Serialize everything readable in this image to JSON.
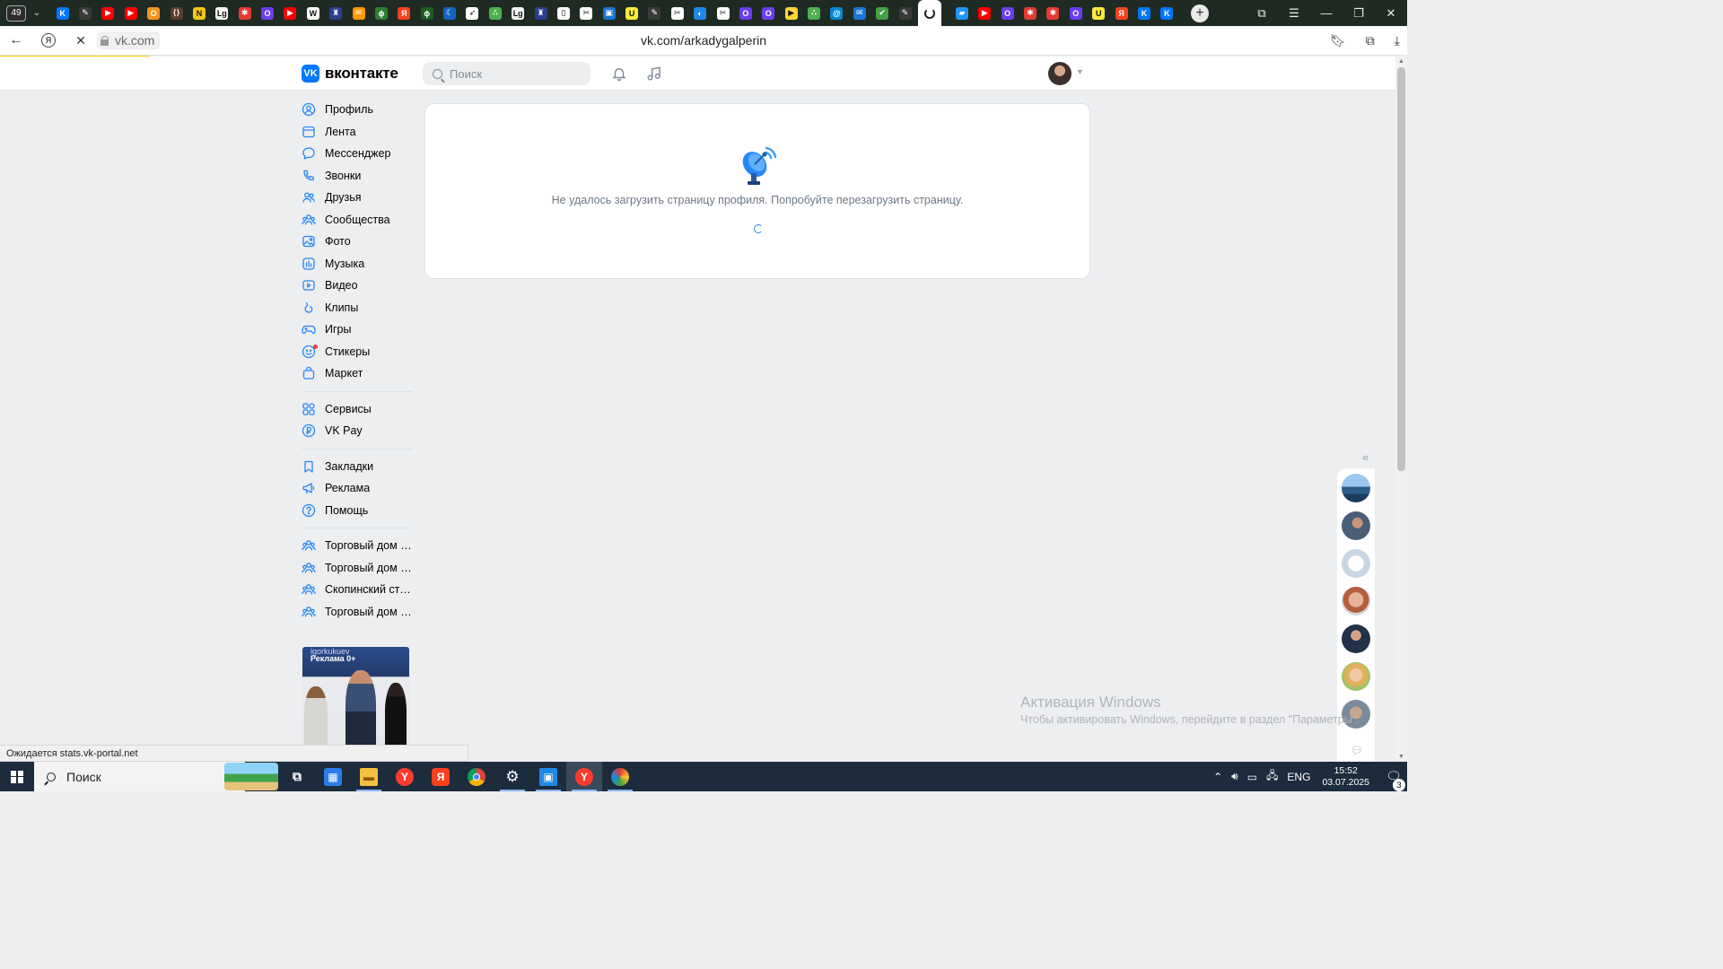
{
  "browser": {
    "tab_count": "49",
    "tab_icons": [
      {
        "name": "vk-icon",
        "color": "#0077ff",
        "glyph": "K"
      },
      {
        "name": "pen-icon",
        "color": "#3a3a3a",
        "glyph": "✎"
      },
      {
        "name": "youtube-icon",
        "color": "#ff0000",
        "glyph": "▶"
      },
      {
        "name": "youtube-icon",
        "color": "#ff0000",
        "glyph": "▶"
      },
      {
        "name": "ok-icon",
        "color": "#f7931e",
        "glyph": "O"
      },
      {
        "name": "code-icon",
        "color": "#5a3d2b",
        "glyph": "⟨⟩"
      },
      {
        "name": "n-icon",
        "color": "#f5c518",
        "glyph": "N"
      },
      {
        "name": "lg-icon",
        "color": "#f5f5f5",
        "glyph": "Lg"
      },
      {
        "name": "star-icon",
        "color": "#e53935",
        "glyph": "✱"
      },
      {
        "name": "o-icon",
        "color": "#6a3df0",
        "glyph": "O"
      },
      {
        "name": "youtube-icon",
        "color": "#ff0000",
        "glyph": "▶"
      },
      {
        "name": "w-icon",
        "color": "#ffffff",
        "glyph": "W"
      },
      {
        "name": "emblem-icon",
        "color": "#2a3f8f",
        "glyph": "♜"
      },
      {
        "name": "mail-icon",
        "color": "#ff9800",
        "glyph": "✉"
      },
      {
        "name": "leaf-icon",
        "color": "#2e7d32",
        "glyph": "ϕ"
      },
      {
        "name": "yandex-icon",
        "color": "#fc3f1d",
        "glyph": "Я"
      },
      {
        "name": "leaf-icon",
        "color": "#1b5e20",
        "glyph": "ϕ"
      },
      {
        "name": "moon-icon",
        "color": "#1565c0",
        "glyph": "☾"
      },
      {
        "name": "compass-icon",
        "color": "#ffffff",
        "glyph": "➶"
      },
      {
        "name": "dots-icon",
        "color": "#4caf50",
        "glyph": "∴"
      },
      {
        "name": "lg-icon",
        "color": "#f5f5f5",
        "glyph": "Lg"
      },
      {
        "name": "emblem-icon",
        "color": "#2a3f8f",
        "glyph": "♜"
      },
      {
        "name": "doc-icon",
        "color": "#ffffff",
        "glyph": "▯"
      },
      {
        "name": "tools-icon",
        "color": "#ffffff",
        "glyph": "✂"
      },
      {
        "name": "news-icon",
        "color": "#1976d2",
        "glyph": "▣"
      },
      {
        "name": "u-icon",
        "color": "#ffeb3b",
        "glyph": "U"
      },
      {
        "name": "pen-icon",
        "color": "#3a3a3a",
        "glyph": "✎"
      },
      {
        "name": "tools-icon",
        "color": "#ffffff",
        "glyph": "✂"
      },
      {
        "name": "globe-icon",
        "color": "#1e88e5",
        "glyph": "◐"
      },
      {
        "name": "tools-icon",
        "color": "#ffffff",
        "glyph": "✂"
      },
      {
        "name": "o-icon",
        "color": "#6a3df0",
        "glyph": "O"
      },
      {
        "name": "o-icon",
        "color": "#6a3df0",
        "glyph": "O"
      },
      {
        "name": "play-icon",
        "color": "#fdd835",
        "glyph": "▶"
      },
      {
        "name": "dots-icon",
        "color": "#4caf50",
        "glyph": "∴"
      },
      {
        "name": "at-icon",
        "color": "#0288d1",
        "glyph": "@"
      },
      {
        "name": "mail-icon",
        "color": "#1976d2",
        "glyph": "✉"
      },
      {
        "name": "check-icon",
        "color": "#43a047",
        "glyph": "✔"
      },
      {
        "name": "pen-icon",
        "color": "#3a3a3a",
        "glyph": "✎"
      }
    ],
    "tab_icons_after": [
      {
        "name": "chat-icon",
        "color": "#2196f3",
        "glyph": "▰"
      },
      {
        "name": "youtube-icon",
        "color": "#ff0000",
        "glyph": "▶"
      },
      {
        "name": "o-icon",
        "color": "#6a3df0",
        "glyph": "O"
      },
      {
        "name": "star-icon",
        "color": "#e53935",
        "glyph": "✱"
      },
      {
        "name": "star-icon",
        "color": "#e53935",
        "glyph": "✱"
      },
      {
        "name": "o-icon",
        "color": "#6a3df0",
        "glyph": "O"
      },
      {
        "name": "u-icon",
        "color": "#ffeb3b",
        "glyph": "U"
      },
      {
        "name": "yandex-icon",
        "color": "#fc3f1d",
        "glyph": "Я"
      },
      {
        "name": "vk-icon",
        "color": "#0077ff",
        "glyph": "K"
      },
      {
        "name": "vk-icon",
        "color": "#0077ff",
        "glyph": "K"
      }
    ],
    "domain": "vk.com",
    "url": "vk.com/arkadygalperin",
    "status": "Ожидается stats.vk-portal.net"
  },
  "vk": {
    "logo_text": "вконтакте",
    "search_placeholder": "Поиск",
    "nav_main": [
      {
        "label": "Профиль",
        "icon": "user-circle-icon"
      },
      {
        "label": "Лента",
        "icon": "newsfeed-icon"
      },
      {
        "label": "Мессенджер",
        "icon": "message-icon"
      },
      {
        "label": "Звонки",
        "icon": "phone-icon"
      },
      {
        "label": "Друзья",
        "icon": "users-icon"
      },
      {
        "label": "Сообщества",
        "icon": "community-icon"
      },
      {
        "label": "Фото",
        "icon": "photo-icon"
      },
      {
        "label": "Музыка",
        "icon": "music-icon"
      },
      {
        "label": "Видео",
        "icon": "video-icon"
      },
      {
        "label": "Клипы",
        "icon": "clips-icon"
      },
      {
        "label": "Игры",
        "icon": "gamepad-icon"
      },
      {
        "label": "Стикеры",
        "icon": "smile-icon"
      },
      {
        "label": "Маркет",
        "icon": "bag-icon"
      }
    ],
    "nav_services": [
      {
        "label": "Сервисы",
        "icon": "services-icon"
      },
      {
        "label": "VK Pay",
        "icon": "vkpay-icon"
      }
    ],
    "nav_extra": [
      {
        "label": "Закладки",
        "icon": "bookmark-icon"
      },
      {
        "label": "Реклама",
        "icon": "megaphone-icon"
      },
      {
        "label": "Помощь",
        "icon": "help-icon"
      }
    ],
    "nav_groups": [
      {
        "label": "Торговый дом \"Зо...",
        "icon": "group-icon"
      },
      {
        "label": "Торговый дом \"Эв...",
        "icon": "group-icon"
      },
      {
        "label": "Скопинский стеко...",
        "icon": "group-icon"
      },
      {
        "label": "Торговый дом \"Эв...",
        "icon": "group-icon"
      }
    ],
    "ad": {
      "username": "igorkukuev",
      "label": "Реклама 0+"
    },
    "error_message": "Не удалось загрузить страницу профиля. Попробуйте перезагрузить страницу."
  },
  "watermark": {
    "title": "Активация Windows",
    "subtitle": "Чтобы активировать Windows, перейдите в раздел \"Параметры\"."
  },
  "taskbar": {
    "search_text": "Поиск",
    "lang": "ENG",
    "time": "15:52",
    "date": "03.07.2025",
    "notifications": "3"
  }
}
